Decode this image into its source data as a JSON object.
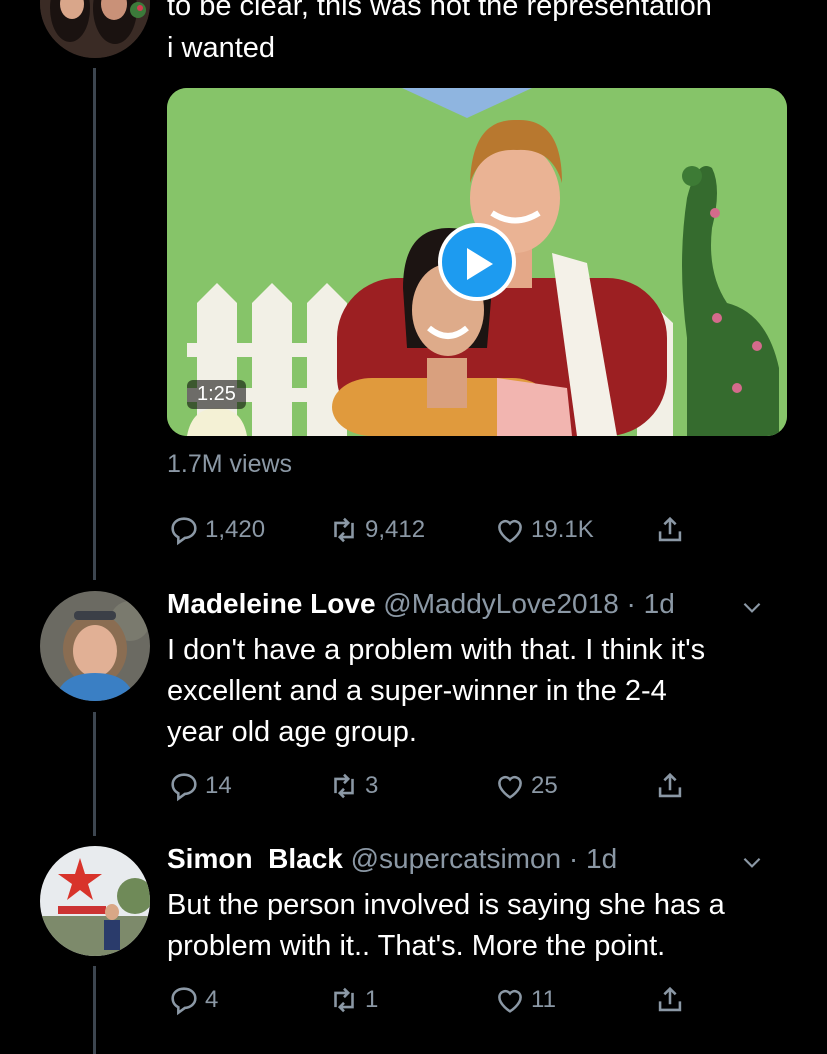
{
  "tweet1": {
    "text_line1": "to be clear, this was not the representation",
    "text_line2": "i wanted",
    "video_duration": "1:25",
    "views": "1.7M views",
    "replies": "1,420",
    "retweets": "9,412",
    "likes": "19.1K"
  },
  "tweet2": {
    "name": "Madeleine Love",
    "meta": "@MaddyLove2018 · 1d",
    "text_line1": "I don't have a problem with that. I think it's",
    "text_line2": "excellent and a super-winner in the 2-4",
    "text_line3": "year old age group.",
    "replies": "14",
    "retweets": "3",
    "likes": "25"
  },
  "tweet3": {
    "name": "Simon  Black",
    "meta": "@supercatsimon · 1d",
    "text_line1": "But the person involved is saying she has a",
    "text_line2": "problem with it.. That's. More the point.",
    "replies": "4",
    "retweets": "1",
    "likes": "11"
  },
  "icons": {
    "reply": "speech-bubble-icon",
    "retweet": "retweet-arrows-icon",
    "like": "heart-icon",
    "share": "share-upload-icon",
    "more": "chevron-down-icon",
    "play": "play-icon"
  },
  "colors": {
    "background": "#000000",
    "secondary_text": "#8b98a5",
    "accent": "#1d9bf0",
    "thread_line": "#3d4650"
  }
}
